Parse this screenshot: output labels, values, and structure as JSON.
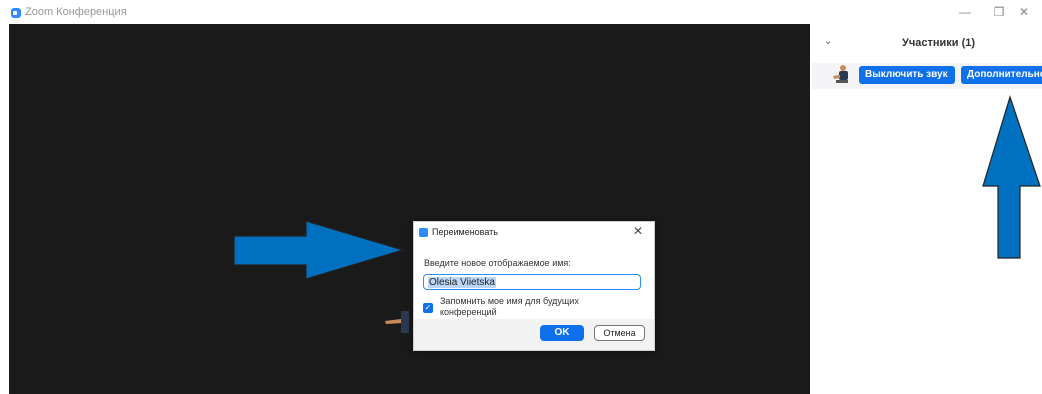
{
  "window": {
    "title": "Zoom Конференция",
    "minimize_glyph": "—",
    "restore_glyph": "❐",
    "close_glyph": "✕"
  },
  "participants": {
    "collapse_glyph": "⌄",
    "title": "Участники (1)",
    "mute_label": "Выключить звук",
    "more_label": "Дополнительно"
  },
  "rename_dialog": {
    "title": "Переименовать",
    "close_glyph": "✕",
    "prompt": "Введите новое отображаемое имя:",
    "name_value": "Olesia Viietska",
    "remember_checked": true,
    "check_glyph": "✓",
    "remember_label": "Запомнить мое имя для будущих конференций",
    "ok_label": "OK",
    "cancel_label": "Отмена"
  },
  "colors": {
    "accent": "#0e71eb",
    "annotation_arrow": "#0070c0"
  }
}
